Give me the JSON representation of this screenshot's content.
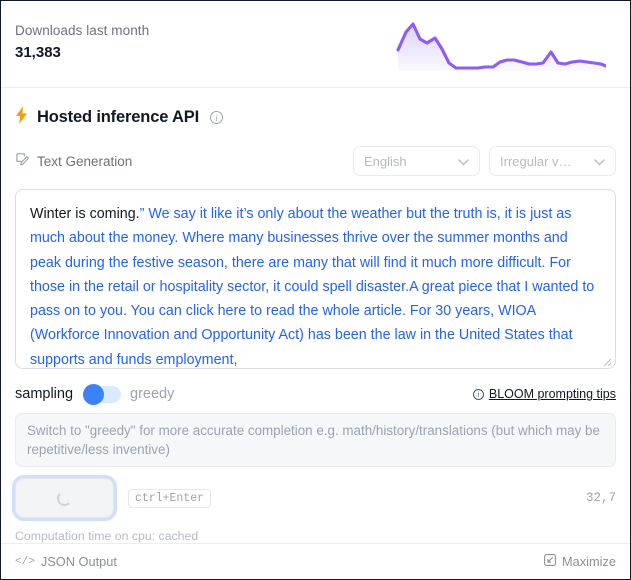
{
  "downloads": {
    "label": "Downloads last month",
    "count": "31,383"
  },
  "chart_data": {
    "type": "area",
    "title": "Downloads last month",
    "xlabel": "",
    "ylabel": "",
    "grid": false,
    "legend": false,
    "line_color": "#8b5cf6",
    "fill_gradient_from": "#ddd3fb",
    "fill_gradient_to": "#f7f5ff",
    "x": [
      0,
      1,
      2,
      3,
      4,
      5,
      6,
      7,
      8,
      9,
      10,
      11,
      12,
      13,
      14,
      15,
      16,
      17,
      18,
      19,
      20,
      21,
      22,
      23,
      24,
      25,
      26,
      27,
      28,
      29
    ],
    "values": [
      42,
      78,
      96,
      72,
      66,
      74,
      60,
      30,
      12,
      10,
      10,
      11,
      11,
      12,
      22,
      26,
      26,
      22,
      18,
      18,
      20,
      44,
      22,
      20,
      24,
      26,
      24,
      22,
      20,
      16
    ],
    "ylim": [
      0,
      100
    ]
  },
  "api": {
    "title": "Hosted inference API",
    "bolt_icon": "lightning-bolt-icon",
    "info_icon": "info-circle-icon",
    "task_icon": "text-generation-icon",
    "task_label": "Text Generation",
    "language_select": {
      "value": "English",
      "caret_icon": "chevron-down-icon"
    },
    "model_select": {
      "value": "Irregular v…",
      "caret_icon": "chevron-down-icon"
    }
  },
  "prompt": {
    "seed_text": "Winter is coming.",
    "generated_text": "” We say it like it’s only about the weather but the truth is, it is just as much about the money. Where many businesses thrive over the summer months and peak during the festive season, there are many that will find it much more difficult. For those in the retail or hospitality sector, it could spell disaster.A great piece that I wanted to pass on to you. You can click here to read the whole article. For 30 years, WIOA (Workforce Innovation and Opportunity Act) has been the law in the United States that supports and funds employment,",
    "resize_handle": "resize-grip-icon"
  },
  "controls": {
    "sampling_label": "sampling",
    "greedy_label": "greedy",
    "toggle_state": "sampling",
    "tips_link": "BLOOM prompting tips",
    "tips_icon": "info-circle-icon",
    "hint": "Switch to \"greedy\" for more accurate completion e.g. math/history/translations (but which may be repetitive/less inventive)",
    "compute_button_icon": "loading-spinner-icon",
    "shortcut": "ctrl+Enter",
    "token_count": "32,7",
    "computation_time": "Computation time on cpu: cached"
  },
  "footer": {
    "json_output_label": "JSON Output",
    "json_output_icon": "code-brackets-icon",
    "maximize_label": "Maximize",
    "maximize_icon": "maximize-icon"
  }
}
